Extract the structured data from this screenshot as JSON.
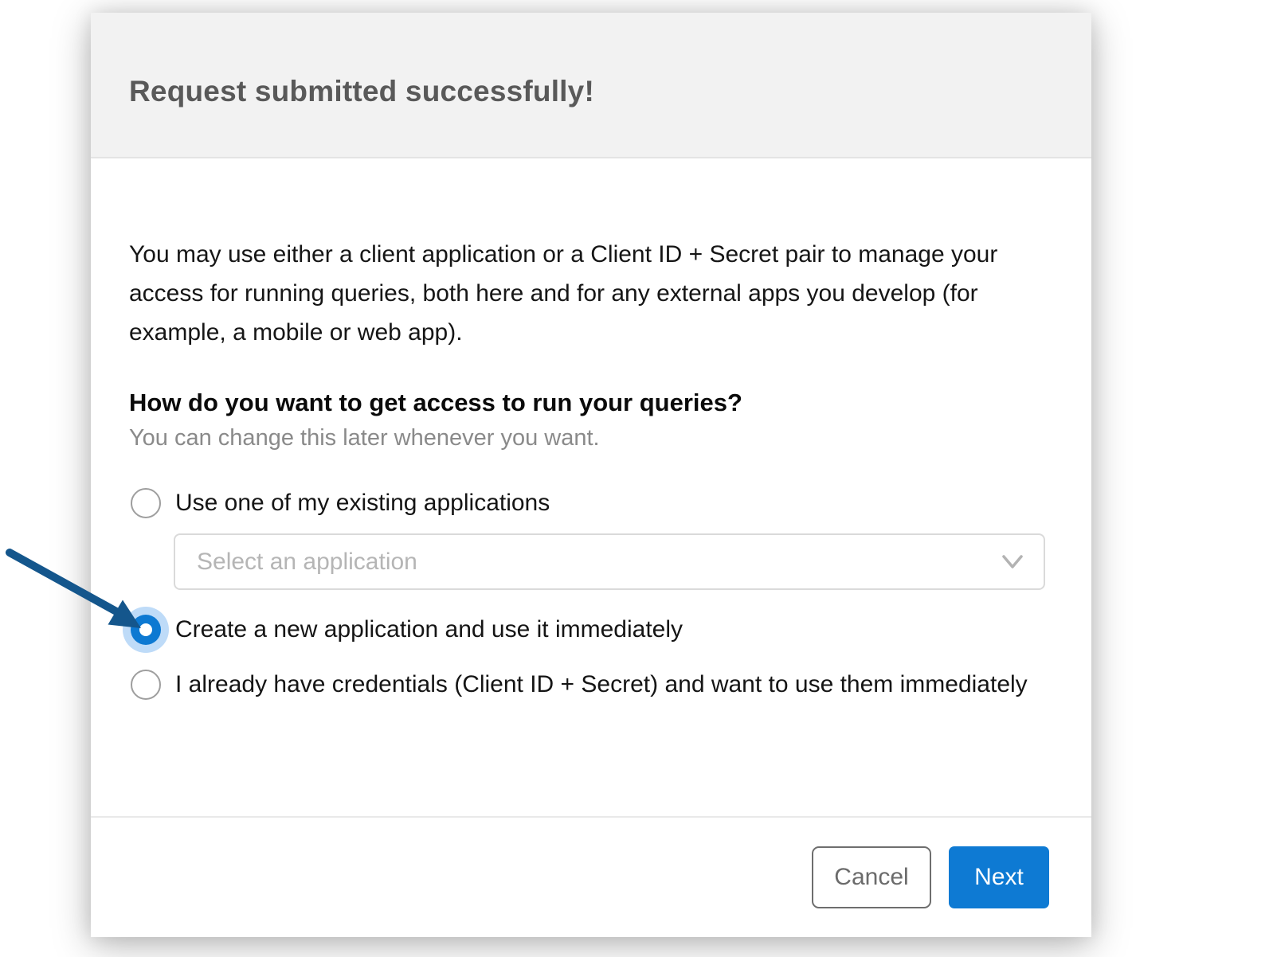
{
  "modal": {
    "title": "Request submitted successfully!",
    "intro": "You may use either a client application or a Client ID + Secret pair to manage your access for running queries, both here and for any external apps you develop (for example, a mobile or web app).",
    "question": "How do you want to get access to run your queries?",
    "question_hint": "You can change this later whenever you want.",
    "options": [
      {
        "label": "Use one of my existing applications",
        "selected": false
      },
      {
        "label": "Create a new application and use it immediately",
        "selected": true
      },
      {
        "label": "I already have credentials (Client ID + Secret) and want to use them immediately",
        "selected": false
      }
    ],
    "application_select": {
      "placeholder": "Select an application"
    },
    "footer": {
      "cancel_label": "Cancel",
      "next_label": "Next"
    }
  },
  "annotation": {
    "type": "arrow",
    "points_to": "create-new-application-radio",
    "color": "#14568c"
  },
  "colors": {
    "header_background": "#f2f2f2",
    "title_text": "#595959",
    "accent_blue": "#0e7ad3",
    "radio_selected_fill": "#0d79d2",
    "radio_selected_halo": "#bedbf8",
    "arrow_blue": "#14568c"
  }
}
